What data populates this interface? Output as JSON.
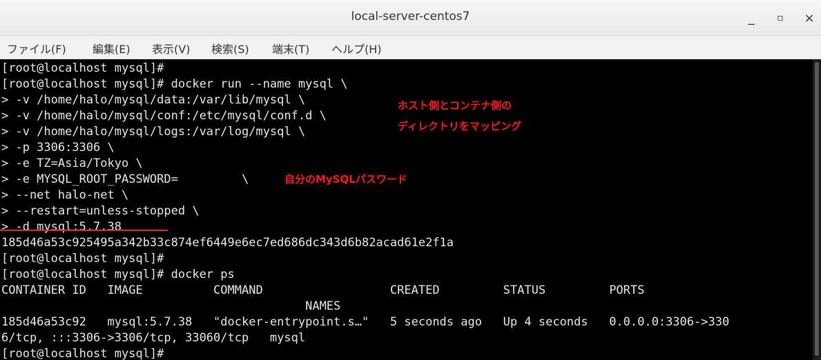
{
  "window": {
    "title": "local-server-centos7",
    "minimize_glyph": "_",
    "maximize_glyph": "▫",
    "close_glyph": "×"
  },
  "menu": {
    "items": [
      {
        "label": "ファイル(F)"
      },
      {
        "label": "編集(E)"
      },
      {
        "label": "表示(V)"
      },
      {
        "label": "検索(S)"
      },
      {
        "label": "端末(T)"
      },
      {
        "label": "ヘルプ(H)"
      }
    ]
  },
  "terminal": {
    "lines": [
      "[root@localhost mysql]#",
      "[root@localhost mysql]# docker run --name mysql \\",
      "> -v /home/halo/mysql/data:/var/lib/mysql \\",
      "> -v /home/halo/mysql/conf:/etc/mysql/conf.d \\",
      "> -v /home/halo/mysql/logs:/var/log/mysql \\",
      "> -p 3306:3306 \\",
      "> -e TZ=Asia/Tokyo \\",
      "> -e MYSQL_ROOT_PASSWORD=         \\",
      "> --net halo-net \\",
      "> --restart=unless-stopped \\",
      "> -d mysql:5.7.38",
      "185d46a53c925495a342b33c874ef6449e6ec7ed686dc343d6b82acad61e2f1a",
      "[root@localhost mysql]#",
      "[root@localhost mysql]# docker ps",
      "CONTAINER ID   IMAGE          COMMAND                  CREATED         STATUS         PORTS",
      "                                           NAMES",
      "185d46a53c92   mysql:5.7.38   \"docker-entrypoint.s…\"   5 seconds ago   Up 4 seconds   0.0.0.0:3306->330",
      "6/tcp, :::3306->3306/tcp, 33060/tcp   mysql",
      "[root@localhost mysql]#"
    ]
  },
  "annotations": {
    "volume_line1": "ホスト側とコンテナ側の",
    "volume_line2": "ディレクトリをマッピング",
    "password_note": "自分のMySQLパスワード",
    "accent_color": "#ff1a1a"
  }
}
